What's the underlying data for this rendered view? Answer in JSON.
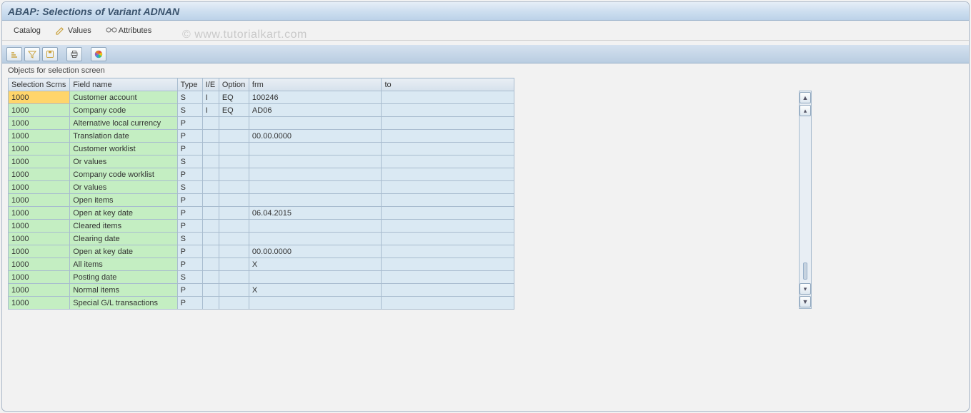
{
  "title": "ABAP: Selections of Variant ADNAN",
  "watermark": "© www.tutorialkart.com",
  "menu": {
    "catalog": "Catalog",
    "values": "Values",
    "attributes": "Attributes"
  },
  "section_label": "Objects for selection screen",
  "columns": {
    "scrn": "Selection Scrns",
    "field": "Field name",
    "type": "Type",
    "ie": "I/E",
    "option": "Option",
    "frm": "frm",
    "to": "to"
  },
  "rows": [
    {
      "scrn": "1000",
      "field": "Customer account",
      "type": "S",
      "ie": "I",
      "option": "EQ",
      "frm": "100246",
      "to": "",
      "selected": true
    },
    {
      "scrn": "1000",
      "field": "Company code",
      "type": "S",
      "ie": "I",
      "option": "EQ",
      "frm": "AD06",
      "to": ""
    },
    {
      "scrn": "1000",
      "field": "Alternative local currency",
      "type": "P",
      "ie": "",
      "option": "",
      "frm": "",
      "to": ""
    },
    {
      "scrn": "1000",
      "field": "Translation date",
      "type": "P",
      "ie": "",
      "option": "",
      "frm": "00.00.0000",
      "to": ""
    },
    {
      "scrn": "1000",
      "field": "Customer worklist",
      "type": "P",
      "ie": "",
      "option": "",
      "frm": "",
      "to": ""
    },
    {
      "scrn": "1000",
      "field": "Or values",
      "type": "S",
      "ie": "",
      "option": "",
      "frm": "",
      "to": ""
    },
    {
      "scrn": "1000",
      "field": "Company code worklist",
      "type": "P",
      "ie": "",
      "option": "",
      "frm": "",
      "to": ""
    },
    {
      "scrn": "1000",
      "field": "Or values",
      "type": "S",
      "ie": "",
      "option": "",
      "frm": "",
      "to": ""
    },
    {
      "scrn": "1000",
      "field": "Open items",
      "type": "P",
      "ie": "",
      "option": "",
      "frm": "",
      "to": ""
    },
    {
      "scrn": "1000",
      "field": "Open at key date",
      "type": "P",
      "ie": "",
      "option": "",
      "frm": "06.04.2015",
      "to": ""
    },
    {
      "scrn": "1000",
      "field": "Cleared items",
      "type": "P",
      "ie": "",
      "option": "",
      "frm": "",
      "to": ""
    },
    {
      "scrn": "1000",
      "field": "Clearing date",
      "type": "S",
      "ie": "",
      "option": "",
      "frm": "",
      "to": ""
    },
    {
      "scrn": "1000",
      "field": "Open at key date",
      "type": "P",
      "ie": "",
      "option": "",
      "frm": "00.00.0000",
      "to": ""
    },
    {
      "scrn": "1000",
      "field": "All items",
      "type": "P",
      "ie": "",
      "option": "",
      "frm": "X",
      "to": ""
    },
    {
      "scrn": "1000",
      "field": "Posting date",
      "type": "S",
      "ie": "",
      "option": "",
      "frm": "",
      "to": ""
    },
    {
      "scrn": "1000",
      "field": "Normal items",
      "type": "P",
      "ie": "",
      "option": "",
      "frm": "X",
      "to": ""
    },
    {
      "scrn": "1000",
      "field": "Special G/L transactions",
      "type": "P",
      "ie": "",
      "option": "",
      "frm": "",
      "to": ""
    }
  ]
}
